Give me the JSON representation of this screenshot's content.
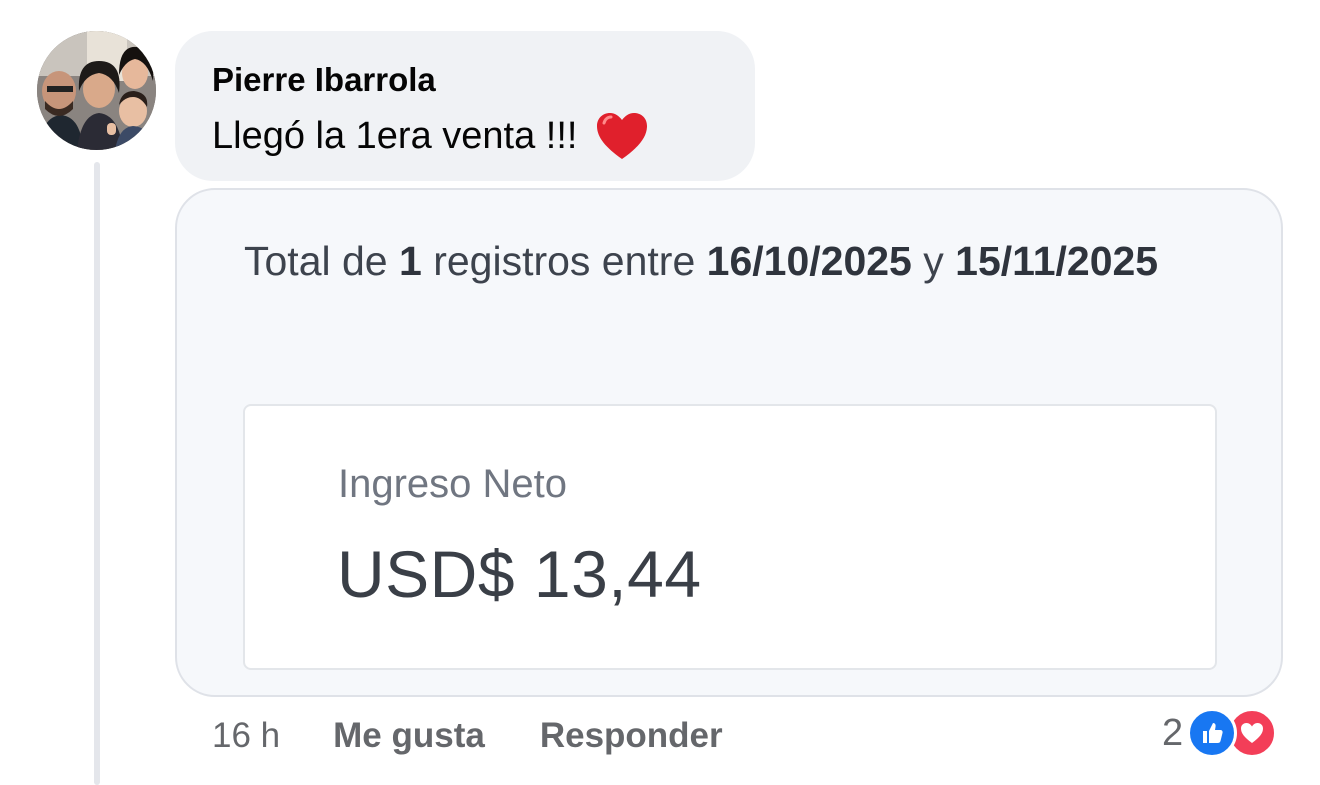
{
  "comment": {
    "author": "Pierre Ibarrola",
    "message": "Llegó la 1era venta !!!",
    "emoji": "red-heart"
  },
  "attachment": {
    "summary": {
      "prefix": "Total de ",
      "count": "1",
      "middle": " registros entre ",
      "date_start": "16/10/2025",
      "connector": " y ",
      "date_end": "15/11/2025"
    },
    "metric": {
      "label": "Ingreso Neto",
      "value": "USD$ 13,44"
    }
  },
  "actions": {
    "time": "16 h",
    "like_label": "Me gusta",
    "reply_label": "Responder"
  },
  "reactions": {
    "count": "2",
    "types": [
      "like",
      "love"
    ]
  },
  "colors": {
    "bubble": "#f0f2f5",
    "like": "#1877f2",
    "love": "#f33e58",
    "secondary_text": "#65676b"
  }
}
